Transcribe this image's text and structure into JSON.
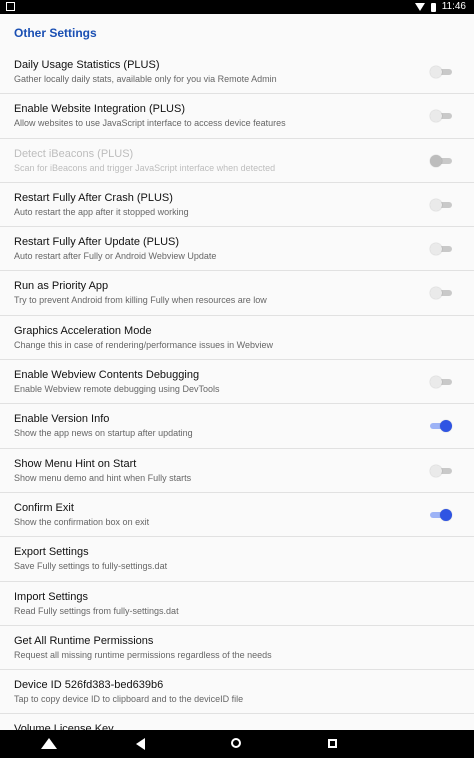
{
  "statusbar": {
    "time": "11:46"
  },
  "section_title": "Other Settings",
  "items": [
    {
      "title": "Daily Usage Statistics (PLUS)",
      "summary": "Gather locally daily stats, available only for you via Remote Admin",
      "toggle": "off",
      "disabled": false
    },
    {
      "title": "Enable Website Integration (PLUS)",
      "summary": "Allow websites to use JavaScript interface to access device features",
      "toggle": "off",
      "disabled": false
    },
    {
      "title": "Detect iBeacons (PLUS)",
      "summary": "Scan for iBeacons and trigger JavaScript interface when detected",
      "toggle": "off",
      "disabled": true
    },
    {
      "title": "Restart Fully After Crash (PLUS)",
      "summary": "Auto restart the app after it stopped working",
      "toggle": "off",
      "disabled": false
    },
    {
      "title": "Restart Fully After Update (PLUS)",
      "summary": "Auto restart after Fully or Android Webview Update",
      "toggle": "off",
      "disabled": false
    },
    {
      "title": "Run as Priority App",
      "summary": "Try to prevent Android from killing Fully when resources are low",
      "toggle": "off",
      "disabled": false
    },
    {
      "title": "Graphics Acceleration Mode",
      "summary": "Change this in case of rendering/performance issues in Webview",
      "toggle": null,
      "disabled": false
    },
    {
      "title": "Enable Webview Contents Debugging",
      "summary": "Enable Webview remote debugging using DevTools",
      "toggle": "off",
      "disabled": false
    },
    {
      "title": "Enable Version Info",
      "summary": "Show the app news on startup after updating",
      "toggle": "on",
      "disabled": false
    },
    {
      "title": "Show Menu Hint on Start",
      "summary": "Show menu demo and hint when Fully starts",
      "toggle": "off",
      "disabled": false
    },
    {
      "title": "Confirm Exit",
      "summary": "Show the confirmation box on exit",
      "toggle": "on",
      "disabled": false
    },
    {
      "title": "Export Settings",
      "summary": "Save Fully settings to fully-settings.dat",
      "toggle": null,
      "disabled": false
    },
    {
      "title": "Import Settings",
      "summary": "Read Fully settings from fully-settings.dat",
      "toggle": null,
      "disabled": false
    },
    {
      "title": "Get All Runtime Permissions",
      "summary": "Request all missing runtime permissions regardless of the needs",
      "toggle": null,
      "disabled": false
    },
    {
      "title": "Device ID 526fd383-bed639b6",
      "summary": "Tap to copy device ID to clipboard and to the deviceID file",
      "toggle": null,
      "disabled": false
    },
    {
      "title": "Volume License Key",
      "summary": "",
      "toggle": null,
      "disabled": false
    }
  ],
  "colors": {
    "accent": "#2f54e3",
    "section_title": "#1a4fb3"
  }
}
